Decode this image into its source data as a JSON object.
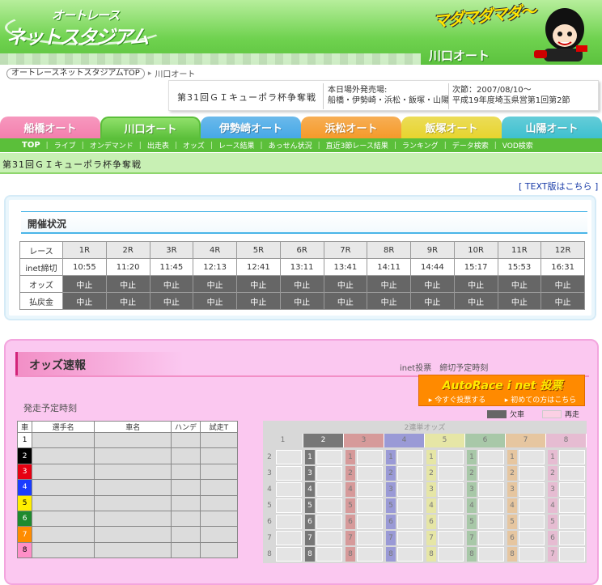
{
  "header": {
    "logo_line1": "オートレース",
    "logo_line2": "ネットスタジアム",
    "slogan": "マダマダマダ〜",
    "venue_title": "川口オート"
  },
  "breadcrumb": {
    "top_label": "オートレースネットスタジアムTOP",
    "current": "川口オート"
  },
  "event": {
    "name": "第31回ＧＩキューポラ杯争奪戦",
    "info_left_line1": "本日場外発売場:",
    "info_left_line2": "船橋・伊勢崎・浜松・飯塚・山陽",
    "info_right_line1": "次節：2007/08/10〜",
    "info_right_line2": "平成19年度埼玉県営第1回第2節"
  },
  "tabs": [
    {
      "label": "船橋オート",
      "color": "#f47fae",
      "active": false
    },
    {
      "label": "川口オート",
      "color": "#5bbf3a",
      "active": true
    },
    {
      "label": "伊勢崎オート",
      "color": "#46a8e6",
      "active": false
    },
    {
      "label": "浜松オート",
      "color": "#f59a2a",
      "active": false
    },
    {
      "label": "飯塚オート",
      "color": "#e7d42e",
      "active": false
    },
    {
      "label": "山陽オート",
      "color": "#3ec0cf",
      "active": false
    }
  ],
  "subnav": [
    "TOP",
    "ライブ",
    "オンデマンド",
    "出走表",
    "オッズ",
    "レース結果",
    "あっせん状況",
    "直近3節レース結果",
    "ランキング",
    "データ検索",
    "VOD検索"
  ],
  "page_title": "第31回ＧＩキューポラ杯争奪戦",
  "text_link": "[ TEXT版はこちら ]",
  "status": {
    "title": "開催状況",
    "row_labels": [
      "レース",
      "inet締切",
      "オッズ",
      "払戻金"
    ],
    "races": [
      "1R",
      "2R",
      "3R",
      "4R",
      "5R",
      "6R",
      "7R",
      "8R",
      "9R",
      "10R",
      "11R",
      "12R"
    ],
    "deadlines": [
      "10:55",
      "11:20",
      "11:45",
      "12:13",
      "12:41",
      "13:11",
      "13:41",
      "14:11",
      "14:44",
      "15:17",
      "15:53",
      "16:31"
    ],
    "odds_status": "中止",
    "payout_status": "中止"
  },
  "odds": {
    "title": "オッズ速報",
    "inet_note": "inet投票　締切予定時刻",
    "banner_title": "AutoRace i net 投票",
    "banner_link1": "今すぐ投票する",
    "banner_link2": "初めての方はこちら",
    "start_label": "発走予定時刻",
    "legend_absent": "欠車",
    "legend_rerun": "再走",
    "racer_headers": [
      "車",
      "選手名",
      "車名",
      "ハンデ",
      "試走T"
    ],
    "car_numbers": [
      "1",
      "2",
      "3",
      "4",
      "5",
      "6",
      "7",
      "8"
    ],
    "car_colors": [
      "#ffffff",
      "#000000",
      "#e60012",
      "#1a3cff",
      "#ffee00",
      "#1e8a2e",
      "#ff8c00",
      "#ff8fc8"
    ],
    "car_text_colors": [
      "#000000",
      "#ffffff",
      "#ffffff",
      "#ffffff",
      "#000000",
      "#ffffff",
      "#ffffff",
      "#000000"
    ],
    "grid_caption": "2連単オッズ",
    "grid_colors": [
      "#d8d8d8",
      "#777777",
      "#d69a9a",
      "#9a9ad6",
      "#e6e6a6",
      "#a8c8a8",
      "#e6c6a0",
      "#e6bcd2"
    ],
    "grid_rows": [
      [
        "2",
        "3",
        "4",
        "5",
        "6",
        "7",
        "8"
      ],
      [
        "1",
        "3",
        "4",
        "5",
        "6",
        "7",
        "8"
      ],
      [
        "1",
        "2",
        "4",
        "5",
        "6",
        "7",
        "8"
      ],
      [
        "1",
        "2",
        "3",
        "5",
        "6",
        "7",
        "8"
      ],
      [
        "1",
        "2",
        "3",
        "4",
        "6",
        "7",
        "8"
      ],
      [
        "1",
        "2",
        "3",
        "4",
        "5",
        "7",
        "8"
      ],
      [
        "1",
        "2",
        "3",
        "4",
        "5",
        "6",
        "8"
      ],
      [
        "1",
        "2",
        "3",
        "4",
        "5",
        "6",
        "7"
      ]
    ]
  },
  "colors": {
    "accent": "#5bbf3a",
    "odds_bg": "#fbc8f0",
    "link": "#1a3ca8"
  }
}
